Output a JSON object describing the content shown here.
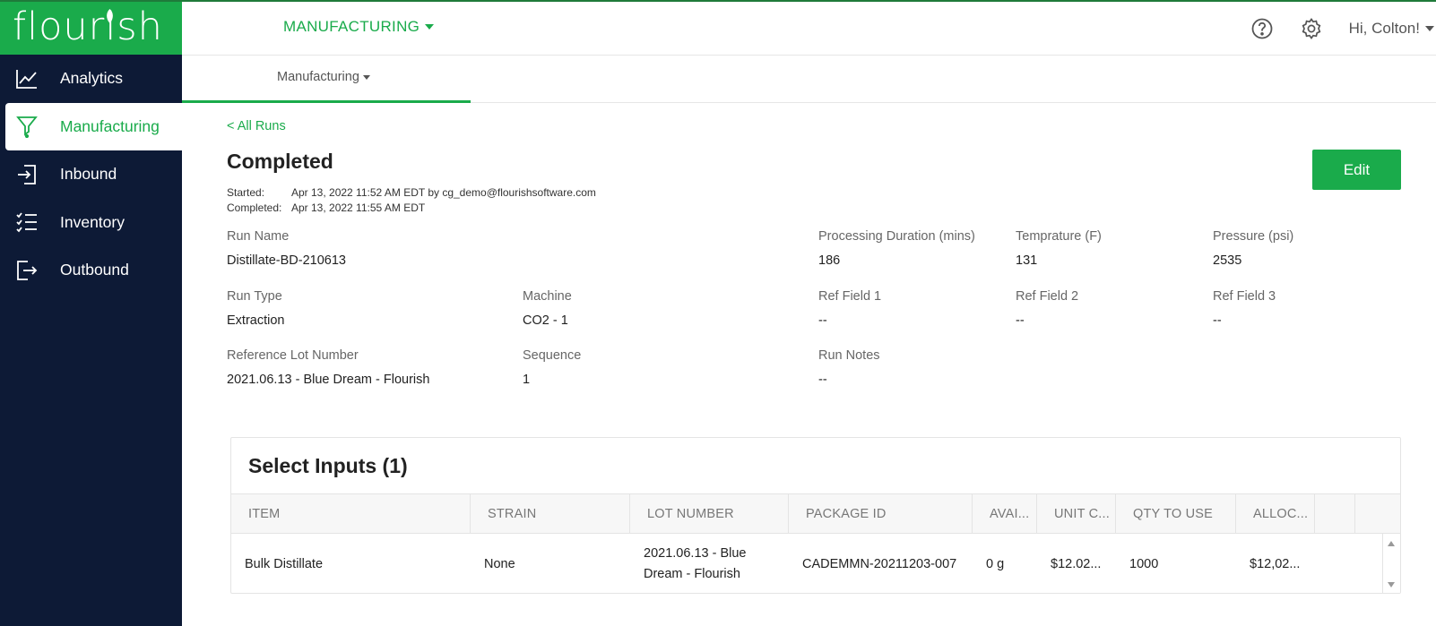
{
  "app": {
    "logo_text": "flourish"
  },
  "colors": {
    "brand_green": "#1aab4b",
    "sidebar_navy": "#0d1a36"
  },
  "sidebar": {
    "items": [
      {
        "label": "Analytics",
        "icon": "line-chart-icon",
        "active": false
      },
      {
        "label": "Manufacturing",
        "icon": "funnel-icon",
        "active": true
      },
      {
        "label": "Inbound",
        "icon": "sign-in-icon",
        "active": false
      },
      {
        "label": "Inventory",
        "icon": "checklist-icon",
        "active": false
      },
      {
        "label": "Outbound",
        "icon": "sign-out-icon",
        "active": false
      }
    ]
  },
  "header": {
    "module": "MANUFACTURING",
    "help_icon": "help-circle-icon",
    "settings_icon": "gear-icon",
    "user_greeting": "Hi, Colton!"
  },
  "subnav": {
    "tab_label": "Manufacturing"
  },
  "run": {
    "back_link": "< All Runs",
    "status": "Completed",
    "edit_label": "Edit",
    "started_label": "Started:",
    "started_value": "Apr 13, 2022 11:52 AM EDT by cg_demo@flourishsoftware.com",
    "completed_label": "Completed:",
    "completed_value": "Apr 13, 2022 11:55 AM EDT",
    "fields": {
      "run_name": {
        "label": "Run Name",
        "value": "Distillate-BD-210613"
      },
      "processing_duration": {
        "label": "Processing Duration (mins)",
        "value": "186"
      },
      "temperature": {
        "label": "Temprature (F)",
        "value": "131"
      },
      "pressure": {
        "label": "Pressure (psi)",
        "value": "2535"
      },
      "run_type": {
        "label": "Run Type",
        "value": "Extraction"
      },
      "machine": {
        "label": "Machine",
        "value": "CO2 - 1"
      },
      "ref_field_1": {
        "label": "Ref Field 1",
        "value": "--"
      },
      "ref_field_2": {
        "label": "Ref Field 2",
        "value": "--"
      },
      "ref_field_3": {
        "label": "Ref Field 3",
        "value": "--"
      },
      "reference_lot": {
        "label": "Reference Lot Number",
        "value": "2021.06.13 - Blue Dream - Flourish"
      },
      "sequence": {
        "label": "Sequence",
        "value": "1"
      },
      "run_notes": {
        "label": "Run Notes",
        "value": "--"
      }
    }
  },
  "inputs": {
    "title": "Select Inputs (1)",
    "columns": [
      "ITEM",
      "STRAIN",
      "LOT NUMBER",
      "PACKAGE ID",
      "AVAI...",
      "UNIT C...",
      "QTY TO USE",
      "ALLOC..."
    ],
    "rows": [
      {
        "item": "Bulk Distillate",
        "strain": "None",
        "lot_number": "2021.06.13 - Blue Dream - Flourish",
        "package_id": "CADEMMN-20211203-007",
        "available": "0 g",
        "unit_cost": "$12.02...",
        "qty_to_use": "1000",
        "allocated": "$12,02..."
      }
    ]
  }
}
